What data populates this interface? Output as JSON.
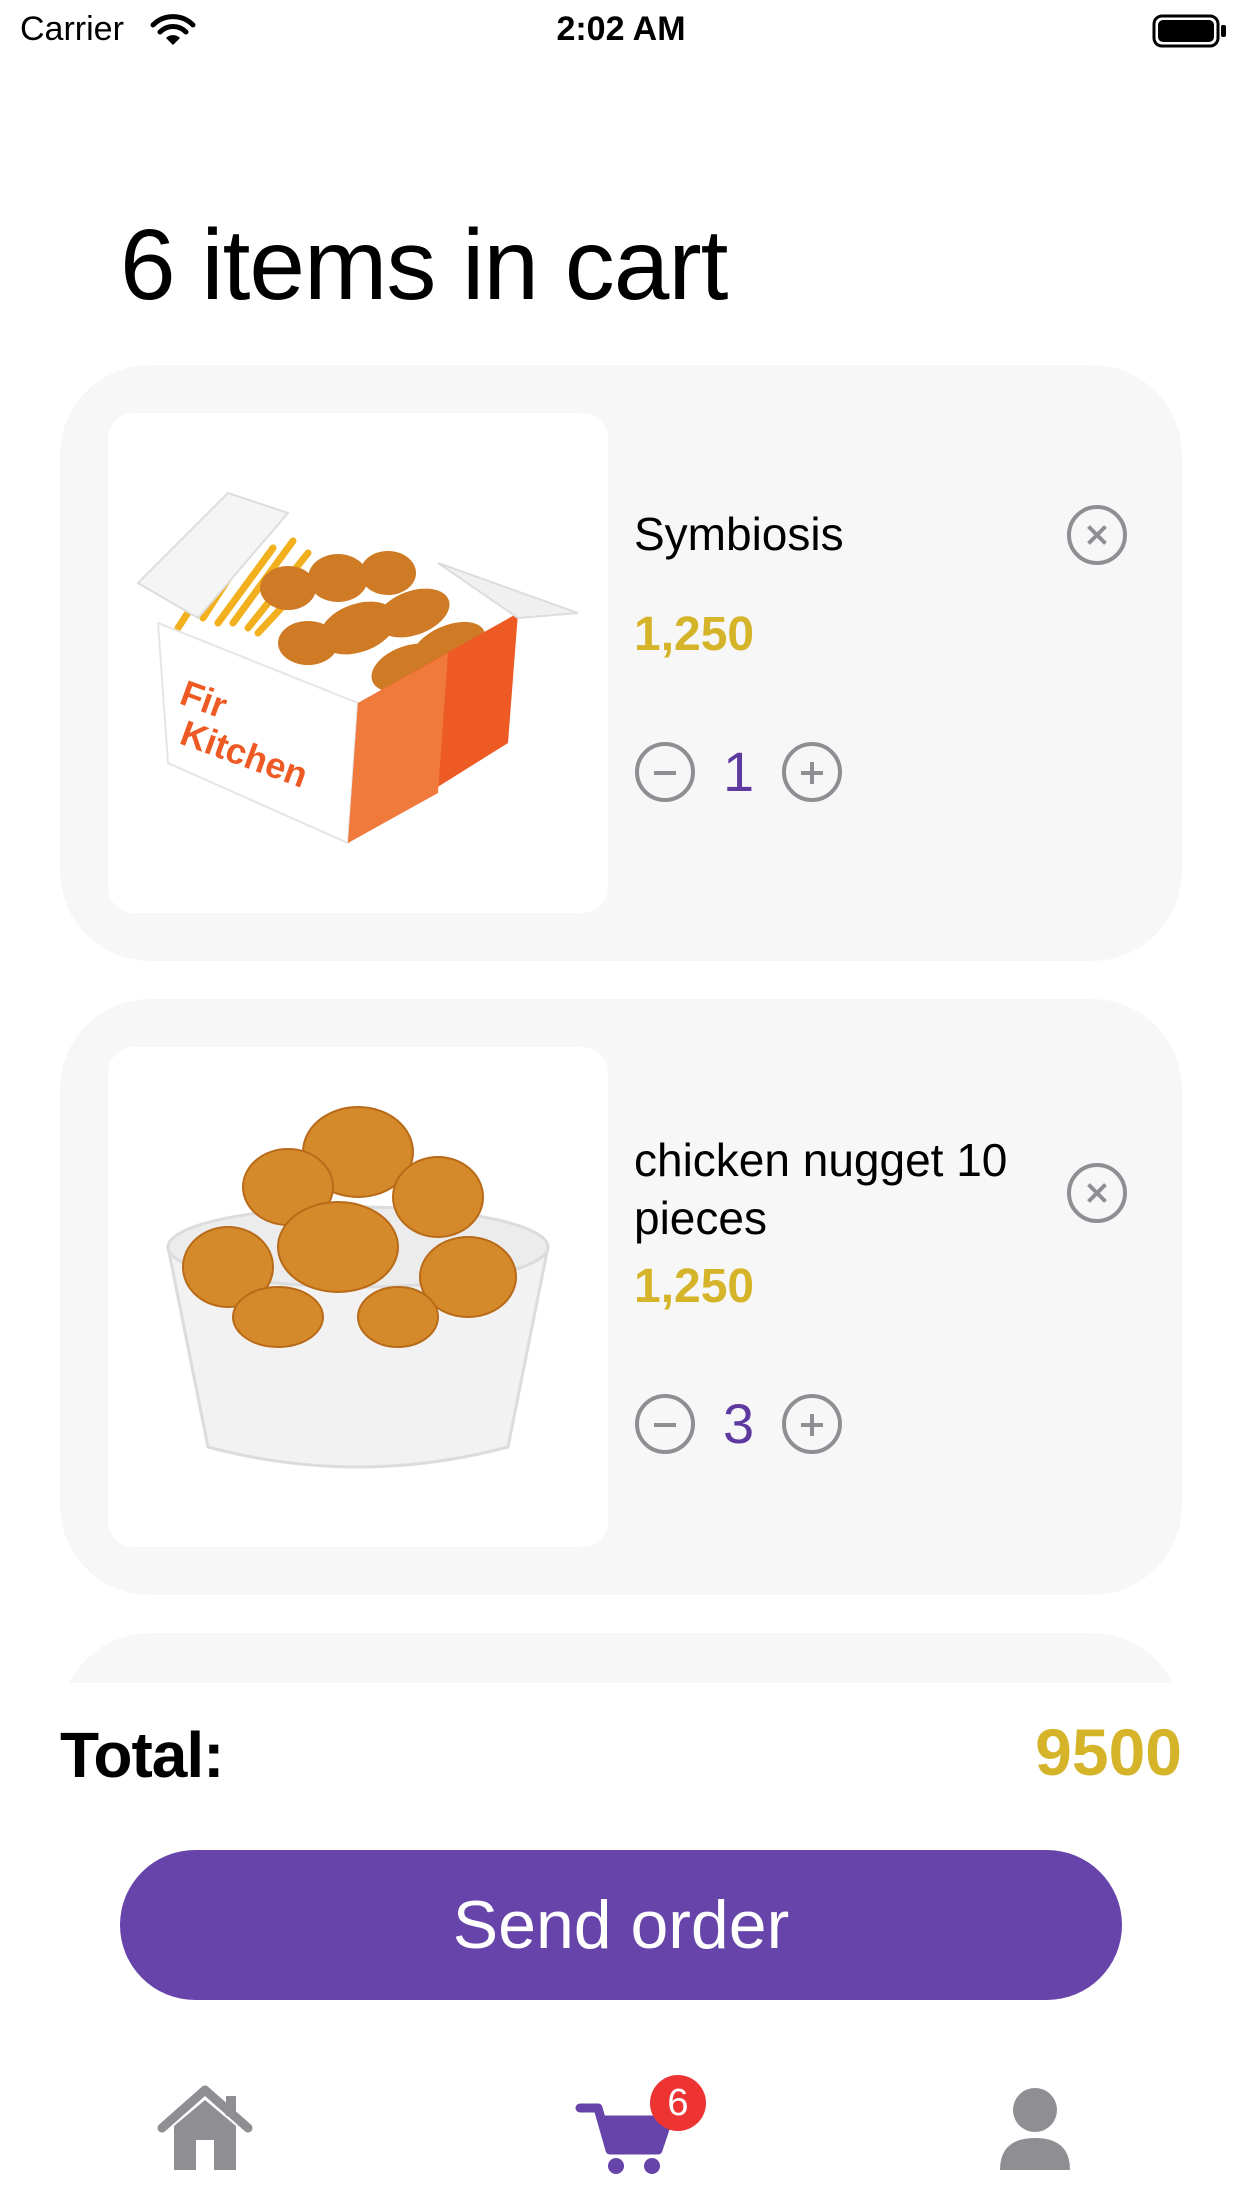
{
  "status_bar": {
    "carrier": "Carrier",
    "time": "2:02 AM",
    "wifi_icon": "wifi-icon",
    "battery_icon": "battery-icon"
  },
  "page": {
    "title": "6 items in cart"
  },
  "cart": {
    "items": [
      {
        "name": "Symbiosis",
        "price": "1,250",
        "quantity": "1",
        "image": "fries-and-nuggets-box",
        "box_text": "Fir Kitchen"
      },
      {
        "name": "chicken nugget 10 pieces",
        "price": "1,250",
        "quantity": "3",
        "image": "chicken-nuggets-bowl"
      }
    ]
  },
  "summary": {
    "total_label": "Total:",
    "total_value": "9500"
  },
  "actions": {
    "send_order_label": "Send order"
  },
  "tab_bar": {
    "tabs": [
      {
        "name": "home",
        "icon": "home-icon",
        "color": "#8e8e93"
      },
      {
        "name": "cart",
        "icon": "cart-icon",
        "color": "#6644aa",
        "badge": "6"
      },
      {
        "name": "profile",
        "icon": "person-icon",
        "color": "#8e8e93"
      }
    ]
  },
  "colors": {
    "accent": "#6644aa",
    "price": "#d6b42a",
    "quantity": "#5e3aa0",
    "card_background": "#f7f7f7",
    "badge": "#ee3333",
    "icon_gray": "#8e8e93"
  }
}
